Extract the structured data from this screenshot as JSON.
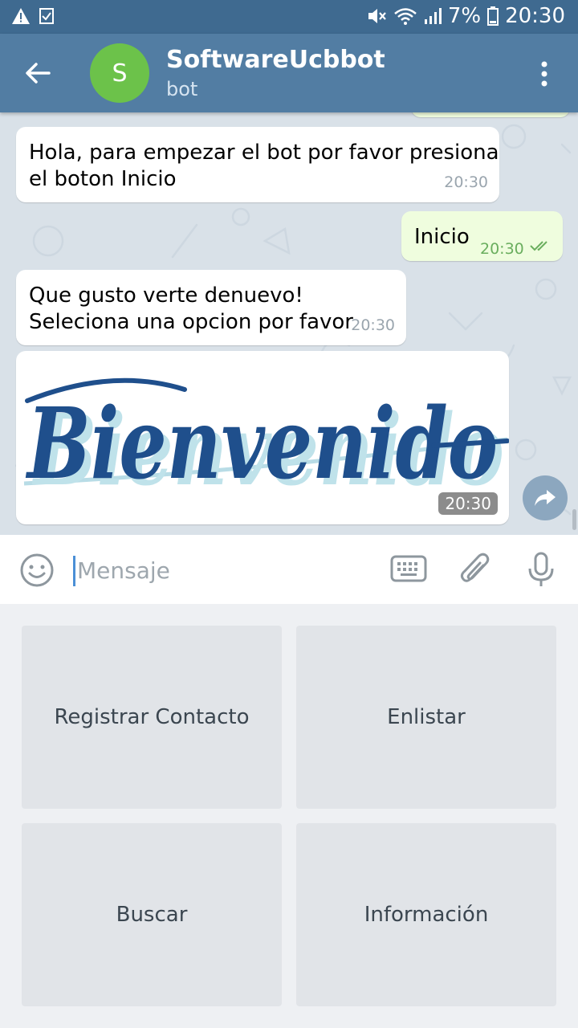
{
  "status_bar": {
    "battery": "7%",
    "time": "20:30",
    "icons": [
      "warning-icon",
      "checklist-icon",
      "mute-icon",
      "wifi-icon",
      "signal-icon",
      "battery-icon"
    ]
  },
  "header": {
    "avatar_letter": "S",
    "title": "SoftwareUcbbot",
    "subtitle": "bot",
    "avatar_color": "#6cc24a",
    "bar_color": "#527da3"
  },
  "messages": [
    {
      "direction": "in",
      "lines": [
        "Hola, para empezar el bot por favor presiona",
        "el boton Inicio"
      ],
      "time": "20:30"
    },
    {
      "direction": "out",
      "text": "Inicio",
      "time": "20:30",
      "read": true
    },
    {
      "direction": "in",
      "lines": [
        "Que gusto verte denuevo!",
        "Seleciona una opcion por favor"
      ],
      "time": "20:30"
    },
    {
      "direction": "in",
      "type": "image",
      "image_text": "Bienvenido",
      "time": "20:30"
    }
  ],
  "composer": {
    "placeholder": "Mensaje",
    "value": ""
  },
  "keyboard": {
    "buttons": [
      "Registrar Contacto",
      "Enlistar",
      "Buscar",
      "Información"
    ]
  }
}
